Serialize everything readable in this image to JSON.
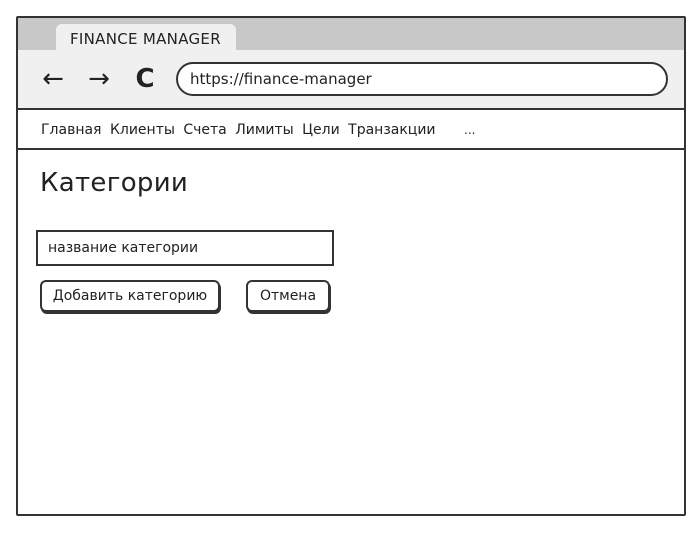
{
  "browser": {
    "tab_title": "FINANCE MANAGER",
    "url": "https://finance-manager"
  },
  "icons": {
    "back": "←",
    "forward": "→",
    "reload": "C"
  },
  "menu": {
    "items": [
      "Главная",
      "Клиенты",
      "Счета",
      "Лимиты",
      "Цели",
      "Транзакции"
    ],
    "more": "..."
  },
  "page": {
    "title": "Категории",
    "name_input_placeholder": "название категории",
    "add_button": "Добавить категорию",
    "cancel_button": "Отмена"
  }
}
